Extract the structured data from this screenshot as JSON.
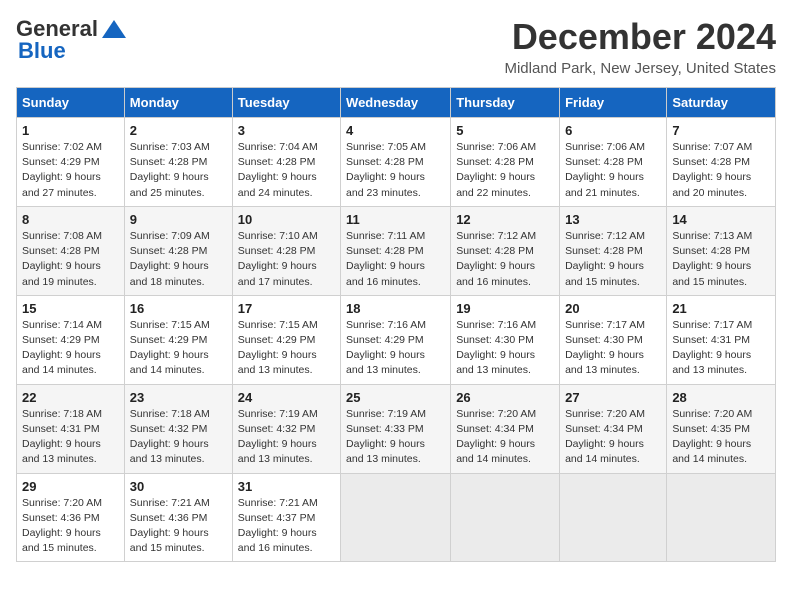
{
  "logo": {
    "general": "General",
    "blue": "Blue"
  },
  "title": "December 2024",
  "subtitle": "Midland Park, New Jersey, United States",
  "days_header": [
    "Sunday",
    "Monday",
    "Tuesday",
    "Wednesday",
    "Thursday",
    "Friday",
    "Saturday"
  ],
  "weeks": [
    [
      {
        "day": "1",
        "sunrise": "Sunrise: 7:02 AM",
        "sunset": "Sunset: 4:29 PM",
        "daylight": "Daylight: 9 hours and 27 minutes."
      },
      {
        "day": "2",
        "sunrise": "Sunrise: 7:03 AM",
        "sunset": "Sunset: 4:28 PM",
        "daylight": "Daylight: 9 hours and 25 minutes."
      },
      {
        "day": "3",
        "sunrise": "Sunrise: 7:04 AM",
        "sunset": "Sunset: 4:28 PM",
        "daylight": "Daylight: 9 hours and 24 minutes."
      },
      {
        "day": "4",
        "sunrise": "Sunrise: 7:05 AM",
        "sunset": "Sunset: 4:28 PM",
        "daylight": "Daylight: 9 hours and 23 minutes."
      },
      {
        "day": "5",
        "sunrise": "Sunrise: 7:06 AM",
        "sunset": "Sunset: 4:28 PM",
        "daylight": "Daylight: 9 hours and 22 minutes."
      },
      {
        "day": "6",
        "sunrise": "Sunrise: 7:06 AM",
        "sunset": "Sunset: 4:28 PM",
        "daylight": "Daylight: 9 hours and 21 minutes."
      },
      {
        "day": "7",
        "sunrise": "Sunrise: 7:07 AM",
        "sunset": "Sunset: 4:28 PM",
        "daylight": "Daylight: 9 hours and 20 minutes."
      }
    ],
    [
      {
        "day": "8",
        "sunrise": "Sunrise: 7:08 AM",
        "sunset": "Sunset: 4:28 PM",
        "daylight": "Daylight: 9 hours and 19 minutes."
      },
      {
        "day": "9",
        "sunrise": "Sunrise: 7:09 AM",
        "sunset": "Sunset: 4:28 PM",
        "daylight": "Daylight: 9 hours and 18 minutes."
      },
      {
        "day": "10",
        "sunrise": "Sunrise: 7:10 AM",
        "sunset": "Sunset: 4:28 PM",
        "daylight": "Daylight: 9 hours and 17 minutes."
      },
      {
        "day": "11",
        "sunrise": "Sunrise: 7:11 AM",
        "sunset": "Sunset: 4:28 PM",
        "daylight": "Daylight: 9 hours and 16 minutes."
      },
      {
        "day": "12",
        "sunrise": "Sunrise: 7:12 AM",
        "sunset": "Sunset: 4:28 PM",
        "daylight": "Daylight: 9 hours and 16 minutes."
      },
      {
        "day": "13",
        "sunrise": "Sunrise: 7:12 AM",
        "sunset": "Sunset: 4:28 PM",
        "daylight": "Daylight: 9 hours and 15 minutes."
      },
      {
        "day": "14",
        "sunrise": "Sunrise: 7:13 AM",
        "sunset": "Sunset: 4:28 PM",
        "daylight": "Daylight: 9 hours and 15 minutes."
      }
    ],
    [
      {
        "day": "15",
        "sunrise": "Sunrise: 7:14 AM",
        "sunset": "Sunset: 4:29 PM",
        "daylight": "Daylight: 9 hours and 14 minutes."
      },
      {
        "day": "16",
        "sunrise": "Sunrise: 7:15 AM",
        "sunset": "Sunset: 4:29 PM",
        "daylight": "Daylight: 9 hours and 14 minutes."
      },
      {
        "day": "17",
        "sunrise": "Sunrise: 7:15 AM",
        "sunset": "Sunset: 4:29 PM",
        "daylight": "Daylight: 9 hours and 13 minutes."
      },
      {
        "day": "18",
        "sunrise": "Sunrise: 7:16 AM",
        "sunset": "Sunset: 4:29 PM",
        "daylight": "Daylight: 9 hours and 13 minutes."
      },
      {
        "day": "19",
        "sunrise": "Sunrise: 7:16 AM",
        "sunset": "Sunset: 4:30 PM",
        "daylight": "Daylight: 9 hours and 13 minutes."
      },
      {
        "day": "20",
        "sunrise": "Sunrise: 7:17 AM",
        "sunset": "Sunset: 4:30 PM",
        "daylight": "Daylight: 9 hours and 13 minutes."
      },
      {
        "day": "21",
        "sunrise": "Sunrise: 7:17 AM",
        "sunset": "Sunset: 4:31 PM",
        "daylight": "Daylight: 9 hours and 13 minutes."
      }
    ],
    [
      {
        "day": "22",
        "sunrise": "Sunrise: 7:18 AM",
        "sunset": "Sunset: 4:31 PM",
        "daylight": "Daylight: 9 hours and 13 minutes."
      },
      {
        "day": "23",
        "sunrise": "Sunrise: 7:18 AM",
        "sunset": "Sunset: 4:32 PM",
        "daylight": "Daylight: 9 hours and 13 minutes."
      },
      {
        "day": "24",
        "sunrise": "Sunrise: 7:19 AM",
        "sunset": "Sunset: 4:32 PM",
        "daylight": "Daylight: 9 hours and 13 minutes."
      },
      {
        "day": "25",
        "sunrise": "Sunrise: 7:19 AM",
        "sunset": "Sunset: 4:33 PM",
        "daylight": "Daylight: 9 hours and 13 minutes."
      },
      {
        "day": "26",
        "sunrise": "Sunrise: 7:20 AM",
        "sunset": "Sunset: 4:34 PM",
        "daylight": "Daylight: 9 hours and 14 minutes."
      },
      {
        "day": "27",
        "sunrise": "Sunrise: 7:20 AM",
        "sunset": "Sunset: 4:34 PM",
        "daylight": "Daylight: 9 hours and 14 minutes."
      },
      {
        "day": "28",
        "sunrise": "Sunrise: 7:20 AM",
        "sunset": "Sunset: 4:35 PM",
        "daylight": "Daylight: 9 hours and 14 minutes."
      }
    ],
    [
      {
        "day": "29",
        "sunrise": "Sunrise: 7:20 AM",
        "sunset": "Sunset: 4:36 PM",
        "daylight": "Daylight: 9 hours and 15 minutes."
      },
      {
        "day": "30",
        "sunrise": "Sunrise: 7:21 AM",
        "sunset": "Sunset: 4:36 PM",
        "daylight": "Daylight: 9 hours and 15 minutes."
      },
      {
        "day": "31",
        "sunrise": "Sunrise: 7:21 AM",
        "sunset": "Sunset: 4:37 PM",
        "daylight": "Daylight: 9 hours and 16 minutes."
      },
      null,
      null,
      null,
      null
    ]
  ]
}
